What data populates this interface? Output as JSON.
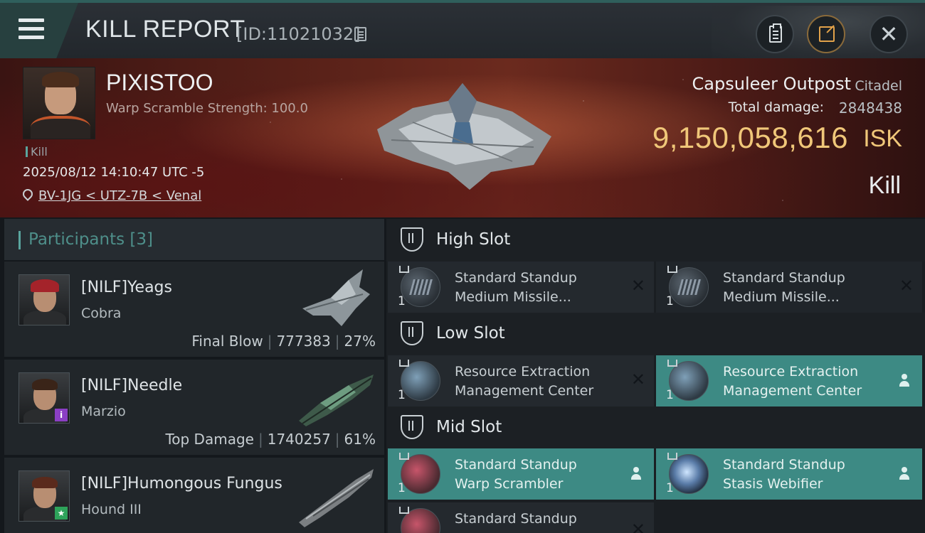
{
  "header": {
    "title": "KILL REPORT",
    "report_id": "[ID:11021032]",
    "menu_icon": "hamburger-icon",
    "actions": [
      {
        "name": "clipboard",
        "icon": "clipboard-icon"
      },
      {
        "name": "export",
        "icon": "export-icon"
      },
      {
        "name": "close",
        "icon": "close-icon",
        "label": "✕"
      }
    ]
  },
  "victim": {
    "name": "PIXISTOO",
    "subtitle": "Warp Scramble Strength: 100.0",
    "kill_tag": "Kill",
    "timestamp": "2025/08/12 14:10:47 UTC -5",
    "location": "BV-1JG < UTZ-7B < Venal",
    "structure_name": "Capsuleer Outpost",
    "structure_type": "Citadel",
    "damage_label": "Total damage:",
    "total_damage": "2848438",
    "isk_value": "9,150,058,616",
    "isk_unit": "ISK",
    "status": "Kill"
  },
  "participants": {
    "title": "Participants",
    "count": "[3]",
    "list": [
      {
        "name": "[NILF]Yeags",
        "ship": "Cobra",
        "role": "Final Blow",
        "damage": "777383",
        "percent": "27%",
        "badge": ""
      },
      {
        "name": "[NILF]Needle",
        "ship": "Marzio",
        "role": "Top Damage",
        "damage": "1740257",
        "percent": "61%",
        "badge": "i"
      },
      {
        "name": "[NILF]Humongous Fungus",
        "ship": "Hound III",
        "role": "",
        "damage": "",
        "percent": "",
        "badge": "★"
      }
    ]
  },
  "slots": {
    "high": {
      "title": "High Slot",
      "modules": [
        {
          "line1": "Standard Standup",
          "line2": "Medium Missile...",
          "qty": "1",
          "state": "dropped"
        },
        {
          "line1": "Standard Standup",
          "line2": "Medium Missile...",
          "qty": "1",
          "state": "dropped"
        }
      ]
    },
    "low": {
      "title": "Low Slot",
      "modules": [
        {
          "line1": "Resource Extraction",
          "line2": "Management Center",
          "qty": "1",
          "state": "dropped"
        },
        {
          "line1": "Resource Extraction",
          "line2": "Management Center",
          "qty": "1",
          "state": "fitted"
        }
      ]
    },
    "mid": {
      "title": "Mid Slot",
      "modules": [
        {
          "line1": "Standard Standup",
          "line2": "Warp Scrambler",
          "qty": "1",
          "state": "fitted"
        },
        {
          "line1": "Standard Standup",
          "line2": "Stasis Webifier",
          "qty": "1",
          "state": "fitted"
        },
        {
          "line1": "Standard Standup",
          "line2": "",
          "qty": "",
          "state": "dropped"
        }
      ]
    }
  },
  "colors": {
    "accent_teal": "#3d8a84",
    "isk_gold": "#f0c779",
    "banner_red": "#5a2219"
  }
}
